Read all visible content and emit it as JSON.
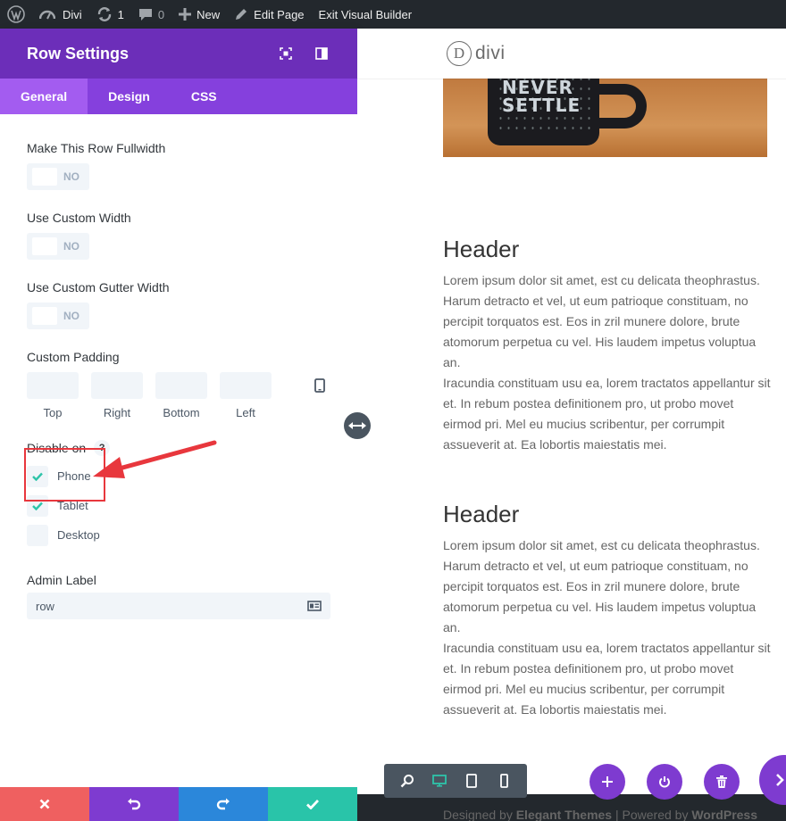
{
  "admin_bar": {
    "site_name": "Divi",
    "updates_count": "1",
    "comments_count": "0",
    "new_label": "New",
    "edit_page_label": "Edit Page",
    "exit_builder_label": "Exit Visual Builder"
  },
  "panel": {
    "title": "Row Settings",
    "tabs": [
      {
        "label": "General",
        "active": true
      },
      {
        "label": "Design",
        "active": false
      },
      {
        "label": "CSS",
        "active": false
      }
    ],
    "fields": {
      "fullwidth": {
        "label": "Make This Row Fullwidth",
        "value": "NO"
      },
      "custom_width": {
        "label": "Use Custom Width",
        "value": "NO"
      },
      "gutter_width": {
        "label": "Use Custom Gutter Width",
        "value": "NO"
      },
      "padding": {
        "label": "Custom Padding",
        "sides": [
          "Top",
          "Right",
          "Bottom",
          "Left"
        ]
      },
      "disable_on": {
        "label": "Disable on",
        "help": "?",
        "options": [
          {
            "label": "Phone",
            "checked": true
          },
          {
            "label": "Tablet",
            "checked": true
          },
          {
            "label": "Desktop",
            "checked": false
          }
        ]
      },
      "admin_label": {
        "label": "Admin Label",
        "value": "row"
      }
    },
    "colors": {
      "header": "#6c2eb9",
      "tabs": "#8540dd",
      "cancel": "#ef6060",
      "undo": "#7e3bd0",
      "redo": "#2b87da",
      "save": "#29c4a9",
      "check": "#2ec4a9",
      "annotation": "#e8373d"
    }
  },
  "preview": {
    "logo_letter": "D",
    "logo_text": "divi",
    "mug_text": "NEVER SETTLE",
    "articles": [
      {
        "heading": "Header",
        "paragraph1": "Lorem ipsum dolor sit amet, est cu delicata theophrastus. Harum detracto et vel, ut eum patrioque constituam, no percipit torquatos est. Eos in zril munere dolore, brute atomorum perpetua cu vel. His laudem impetus voluptua an.",
        "paragraph2": "Iracundia constituam usu ea, lorem tractatos appellantur sit et. In rebum postea definitionem pro, ut probo movet eirmod pri. Mel eu mucius scribentur, per corrumpit assueverit at. Ea lobortis maiestatis mei."
      },
      {
        "heading": "Header",
        "paragraph1": "Lorem ipsum dolor sit amet, est cu delicata theophrastus. Harum detracto et vel, ut eum patrioque constituam, no percipit torquatos est. Eos in zril munere dolore, brute atomorum perpetua cu vel. His laudem impetus voluptua an.",
        "paragraph2": "Iracundia constituam usu ea, lorem tractatos appellantur sit et. In rebum postea definitionem pro, ut probo movet eirmod pri. Mel eu mucius scribentur, per corrumpit assueverit at. Ea lobortis maiestatis mei."
      }
    ],
    "footer": {
      "designed_by": "Designed by",
      "theme_author": "Elegant Themes",
      "separator": "|",
      "powered_by": "Powered by",
      "platform": "WordPress"
    }
  }
}
